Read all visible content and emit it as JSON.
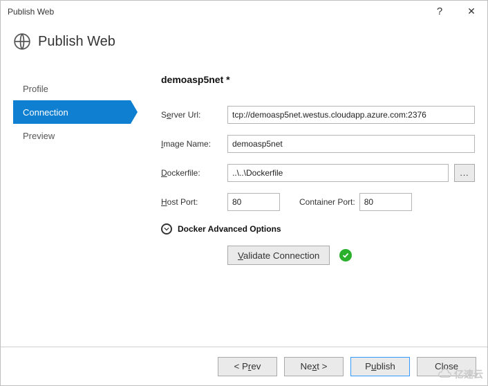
{
  "window": {
    "title": "Publish Web",
    "help_glyph": "?",
    "close_glyph": "✕"
  },
  "header": {
    "title": "Publish Web"
  },
  "nav": {
    "items": [
      {
        "label": "Profile",
        "active": false
      },
      {
        "label": "Connection",
        "active": true
      },
      {
        "label": "Preview",
        "active": false
      }
    ]
  },
  "form": {
    "profile_name": "demoasp5net *",
    "server_url_label_pre": "S",
    "server_url_label_ul": "e",
    "server_url_label_post": "rver Url:",
    "server_url_value": "tcp://demoasp5net.westus.cloudapp.azure.com:2376",
    "image_name_label_ul": "I",
    "image_name_label_post": "mage Name:",
    "image_name_value": "demoasp5net",
    "dockerfile_label_ul": "D",
    "dockerfile_label_post": "ockerfile:",
    "dockerfile_value": "..\\..\\Dockerfile",
    "browse_label": "...",
    "host_port_label_ul": "H",
    "host_port_label_post": "ost Port:",
    "host_port_value": "80",
    "container_port_label": "Container Port:",
    "container_port_value": "80",
    "advanced_label": "Docker Advanced Options",
    "validate_label_ul": "V",
    "validate_label_post": "alidate Connection"
  },
  "footer": {
    "prev_pre": "<  P",
    "prev_ul": "r",
    "prev_post": "ev",
    "next_pre": "Ne",
    "next_ul": "x",
    "next_post": "t  >",
    "publish_pre": "P",
    "publish_ul": "u",
    "publish_post": "blish",
    "close_label": "Close"
  },
  "watermark": "亿速云"
}
